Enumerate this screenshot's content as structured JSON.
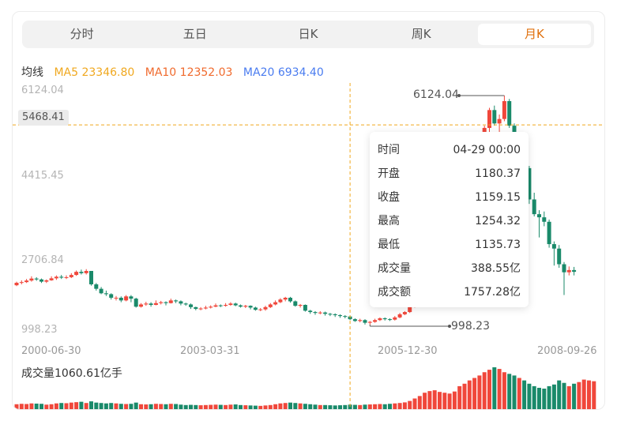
{
  "tabs": [
    {
      "label": "分时",
      "active": false
    },
    {
      "label": "五日",
      "active": false
    },
    {
      "label": "日K",
      "active": false
    },
    {
      "label": "周K",
      "active": false
    },
    {
      "label": "月K",
      "active": true
    }
  ],
  "ma": {
    "title": "均线",
    "ma5": {
      "label": "MA5 23346.80",
      "color": "#f0a81f"
    },
    "ma10": {
      "label": "MA10 12352.03",
      "color": "#f06a2d"
    },
    "ma20": {
      "label": "MA20 6934.40",
      "color": "#4a7cf0"
    }
  },
  "colors": {
    "up": "#f0473b",
    "down": "#1a8a6a",
    "accent": "#e0700c",
    "crosshair": "#f0a81f"
  },
  "crosshair": {
    "value": "5468.41"
  },
  "chart_data": {
    "type": "candlestick",
    "y_ticks": [
      "6124.04",
      "4415.45",
      "2706.84",
      "998.23"
    ],
    "ylim": [
      998.23,
      6124.04
    ],
    "x_ticks": [
      "2000-06-30",
      "2003-03-31",
      "2005-12-30",
      "2008-09-26"
    ],
    "max_label": "6124.04",
    "min_label": "998.23",
    "candles": [
      [
        1880,
        1935,
        1960,
        1860
      ],
      [
        1935,
        1950,
        1990,
        1900
      ],
      [
        1950,
        1985,
        2020,
        1930
      ],
      [
        1985,
        2030,
        2080,
        1960
      ],
      [
        2030,
        2010,
        2060,
        1980
      ],
      [
        2010,
        1960,
        2030,
        1930
      ],
      [
        1960,
        1990,
        2010,
        1930
      ],
      [
        1990,
        2035,
        2080,
        1980
      ],
      [
        2035,
        2070,
        2100,
        2000
      ],
      [
        2070,
        2050,
        2110,
        2020
      ],
      [
        2050,
        2060,
        2100,
        2020
      ],
      [
        2060,
        2110,
        2150,
        2040
      ],
      [
        2110,
        2180,
        2210,
        2090
      ],
      [
        2180,
        2150,
        2230,
        2120
      ],
      [
        2150,
        2200,
        2240,
        2120
      ],
      [
        2200,
        1900,
        2200,
        1870
      ],
      [
        1900,
        1800,
        1930,
        1760
      ],
      [
        1800,
        1700,
        1840,
        1680
      ],
      [
        1700,
        1680,
        1760,
        1640
      ],
      [
        1680,
        1600,
        1700,
        1560
      ],
      [
        1600,
        1600,
        1640,
        1540
      ],
      [
        1600,
        1540,
        1630,
        1500
      ],
      [
        1540,
        1630,
        1660,
        1520
      ],
      [
        1630,
        1580,
        1660,
        1500
      ],
      [
        1580,
        1400,
        1600,
        1380
      ],
      [
        1400,
        1450,
        1480,
        1380
      ],
      [
        1450,
        1470,
        1510,
        1420
      ],
      [
        1470,
        1440,
        1500,
        1400
      ],
      [
        1440,
        1480,
        1540,
        1430
      ],
      [
        1480,
        1500,
        1530,
        1450
      ],
      [
        1500,
        1480,
        1520,
        1430
      ],
      [
        1480,
        1540,
        1580,
        1470
      ],
      [
        1540,
        1520,
        1560,
        1480
      ],
      [
        1520,
        1470,
        1540,
        1430
      ],
      [
        1470,
        1450,
        1490,
        1420
      ],
      [
        1450,
        1390,
        1470,
        1350
      ],
      [
        1390,
        1350,
        1400,
        1320
      ],
      [
        1350,
        1360,
        1390,
        1320
      ],
      [
        1360,
        1380,
        1420,
        1340
      ],
      [
        1380,
        1400,
        1430,
        1360
      ],
      [
        1400,
        1430,
        1470,
        1390
      ],
      [
        1430,
        1420,
        1450,
        1390
      ],
      [
        1420,
        1440,
        1480,
        1400
      ],
      [
        1440,
        1470,
        1500,
        1420
      ],
      [
        1470,
        1430,
        1490,
        1410
      ],
      [
        1430,
        1400,
        1450,
        1380
      ],
      [
        1400,
        1420,
        1440,
        1370
      ],
      [
        1420,
        1380,
        1430,
        1340
      ],
      [
        1380,
        1330,
        1400,
        1310
      ],
      [
        1330,
        1340,
        1370,
        1300
      ],
      [
        1340,
        1390,
        1420,
        1310
      ],
      [
        1390,
        1450,
        1480,
        1370
      ],
      [
        1450,
        1500,
        1540,
        1430
      ],
      [
        1500,
        1560,
        1590,
        1480
      ],
      [
        1560,
        1600,
        1620,
        1520
      ],
      [
        1600,
        1520,
        1620,
        1490
      ],
      [
        1520,
        1420,
        1540,
        1400
      ],
      [
        1420,
        1440,
        1460,
        1380
      ],
      [
        1440,
        1310,
        1450,
        1290
      ],
      [
        1310,
        1280,
        1330,
        1240
      ],
      [
        1280,
        1260,
        1300,
        1220
      ],
      [
        1260,
        1270,
        1300,
        1230
      ],
      [
        1270,
        1240,
        1290,
        1200
      ],
      [
        1240,
        1230,
        1260,
        1190
      ],
      [
        1230,
        1210,
        1250,
        1170
      ],
      [
        1210,
        1190,
        1230,
        1150
      ],
      [
        1190,
        1180,
        1210,
        1140
      ],
      [
        1180,
        1120,
        1200,
        1100
      ],
      [
        1120,
        1080,
        1140,
        1060
      ],
      [
        1080,
        1100,
        1130,
        1050
      ],
      [
        1100,
        1040,
        1120,
        1000
      ],
      [
        1040,
        1060,
        1080,
        998
      ],
      [
        1060,
        1100,
        1130,
        1040
      ],
      [
        1100,
        1140,
        1160,
        1080
      ],
      [
        1140,
        1120,
        1160,
        1090
      ],
      [
        1120,
        1110,
        1140,
        1080
      ],
      [
        1110,
        1160,
        1190,
        1090
      ],
      [
        1160,
        1230,
        1260,
        1140
      ],
      [
        1230,
        1280,
        1300,
        1210
      ],
      [
        1280,
        1400,
        1430,
        1260
      ],
      [
        1400,
        1560,
        1600,
        1380
      ],
      [
        1560,
        1700,
        1740,
        1540
      ],
      [
        1700,
        1780,
        1820,
        1660
      ],
      [
        1780,
        1900,
        1960,
        1750
      ],
      [
        1900,
        2100,
        2150,
        1880
      ],
      [
        2100,
        2400,
        2450,
        2080
      ],
      [
        2400,
        2800,
        2850,
        2380
      ],
      [
        2800,
        3300,
        3350,
        2750
      ],
      [
        3300,
        3700,
        3750,
        3250
      ],
      [
        3700,
        3840,
        3900,
        3600
      ],
      [
        3840,
        3900,
        3950,
        3800
      ],
      [
        3900,
        4100,
        4150,
        3850
      ],
      [
        4100,
        4300,
        4350,
        4050
      ],
      [
        4300,
        4700,
        4750,
        4250
      ],
      [
        4700,
        5400,
        5450,
        4650
      ],
      [
        5400,
        5800,
        5850,
        5300
      ],
      [
        5800,
        5500,
        5900,
        5450
      ],
      [
        5500,
        5600,
        5700,
        5300
      ],
      [
        5600,
        6000,
        6124,
        5550
      ],
      [
        6000,
        5450,
        6050,
        5400
      ],
      [
        5450,
        4700,
        5500,
        4550
      ],
      [
        4700,
        5100,
        5200,
        4550
      ],
      [
        5100,
        4500,
        5150,
        4350
      ],
      [
        4500,
        3800,
        4550,
        3700
      ],
      [
        3800,
        3470,
        3950,
        3420
      ],
      [
        3470,
        3400,
        3560,
        2950
      ],
      [
        3400,
        3300,
        3530,
        3200
      ],
      [
        3300,
        2800,
        3350,
        2720
      ],
      [
        2800,
        2700,
        2860,
        2320
      ],
      [
        2700,
        2350,
        2780,
        2270
      ],
      [
        2350,
        2170,
        2400,
        1660
      ],
      [
        2170,
        2220,
        2300,
        2100
      ],
      [
        2220,
        2180,
        2290,
        2100
      ]
    ],
    "volume": [
      120,
      130,
      125,
      140,
      135,
      130,
      110,
      120,
      140,
      150,
      145,
      160,
      170,
      180,
      150,
      190,
      160,
      150,
      140,
      150,
      140,
      130,
      125,
      130,
      160,
      120,
      115,
      120,
      130,
      125,
      120,
      130,
      125,
      110,
      100,
      105,
      100,
      95,
      100,
      105,
      110,
      105,
      100,
      110,
      115,
      100,
      95,
      90,
      85,
      80,
      90,
      100,
      120,
      140,
      150,
      160,
      150,
      140,
      130,
      120,
      110,
      100,
      100,
      95,
      90,
      95,
      100,
      110,
      105,
      100,
      110,
      115,
      120,
      125,
      120,
      130,
      140,
      150,
      165,
      200,
      260,
      320,
      400,
      440,
      460,
      420,
      400,
      380,
      430,
      560,
      620,
      700,
      760,
      820,
      900,
      960,
      1020,
      980,
      900,
      860,
      820,
      760,
      700,
      620,
      560,
      520,
      500,
      560,
      600,
      700,
      640,
      560,
      620,
      660,
      720,
      700,
      680
    ],
    "vol_max": 1060.61,
    "hover_index": 67
  },
  "tooltip": {
    "rows": [
      {
        "label": "时间",
        "value": "04-29 00:00"
      },
      {
        "label": "开盘",
        "value": "1180.37"
      },
      {
        "label": "收盘",
        "value": "1159.15"
      },
      {
        "label": "最高",
        "value": "1254.32"
      },
      {
        "label": "最低",
        "value": "1135.73"
      },
      {
        "label": "成交量",
        "value": "388.55亿"
      },
      {
        "label": "成交额",
        "value": "1757.28亿"
      }
    ]
  },
  "volume_label": "成交量1060.61亿手"
}
